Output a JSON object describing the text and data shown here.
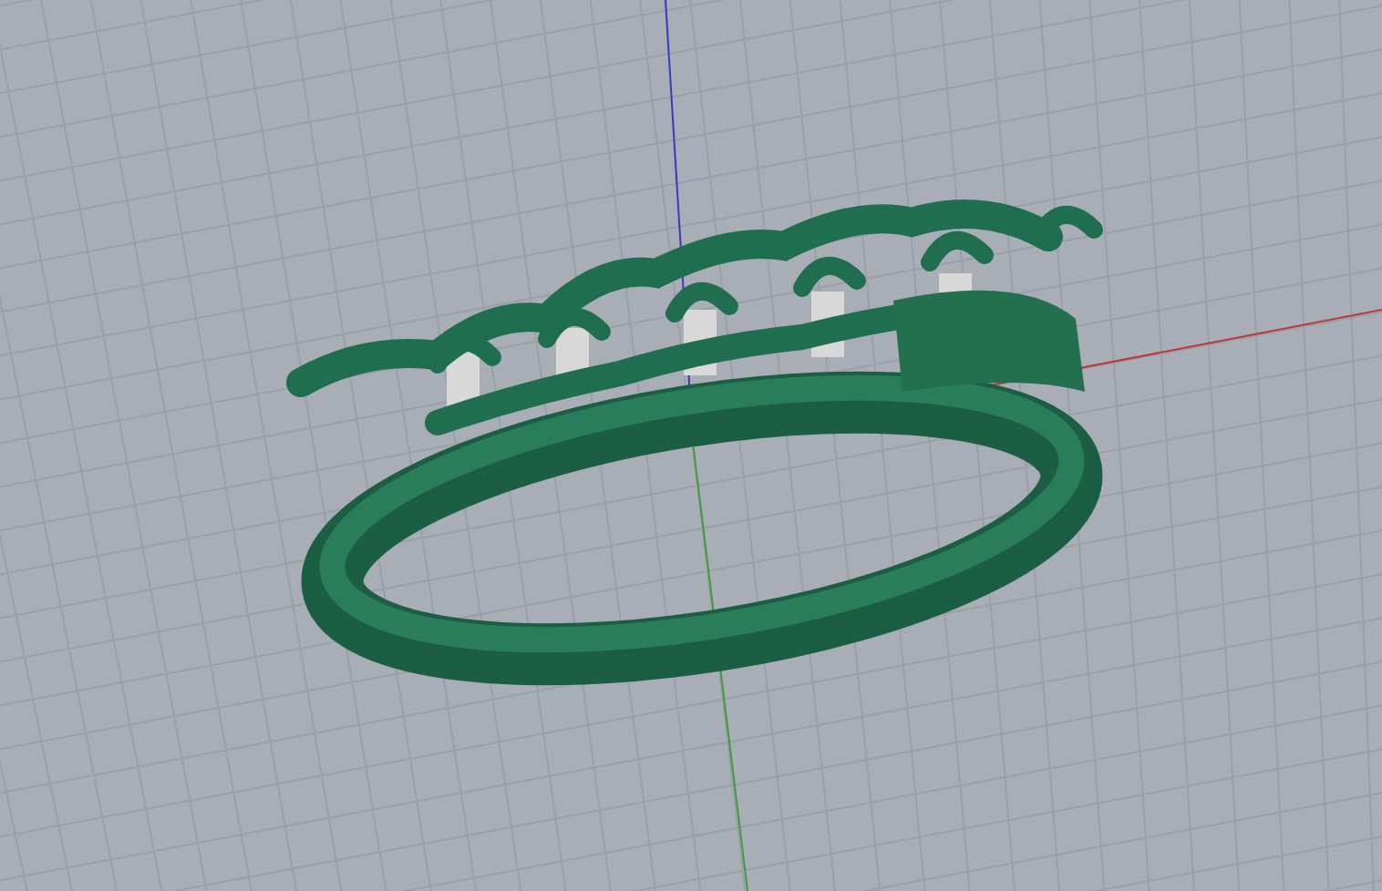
{
  "viewport": {
    "axes": [
      {
        "kind": "x",
        "color": "#b83a3a"
      },
      {
        "kind": "y",
        "color": "#3f9a3f"
      },
      {
        "kind": "z",
        "color": "#3a3ab8"
      }
    ]
  }
}
